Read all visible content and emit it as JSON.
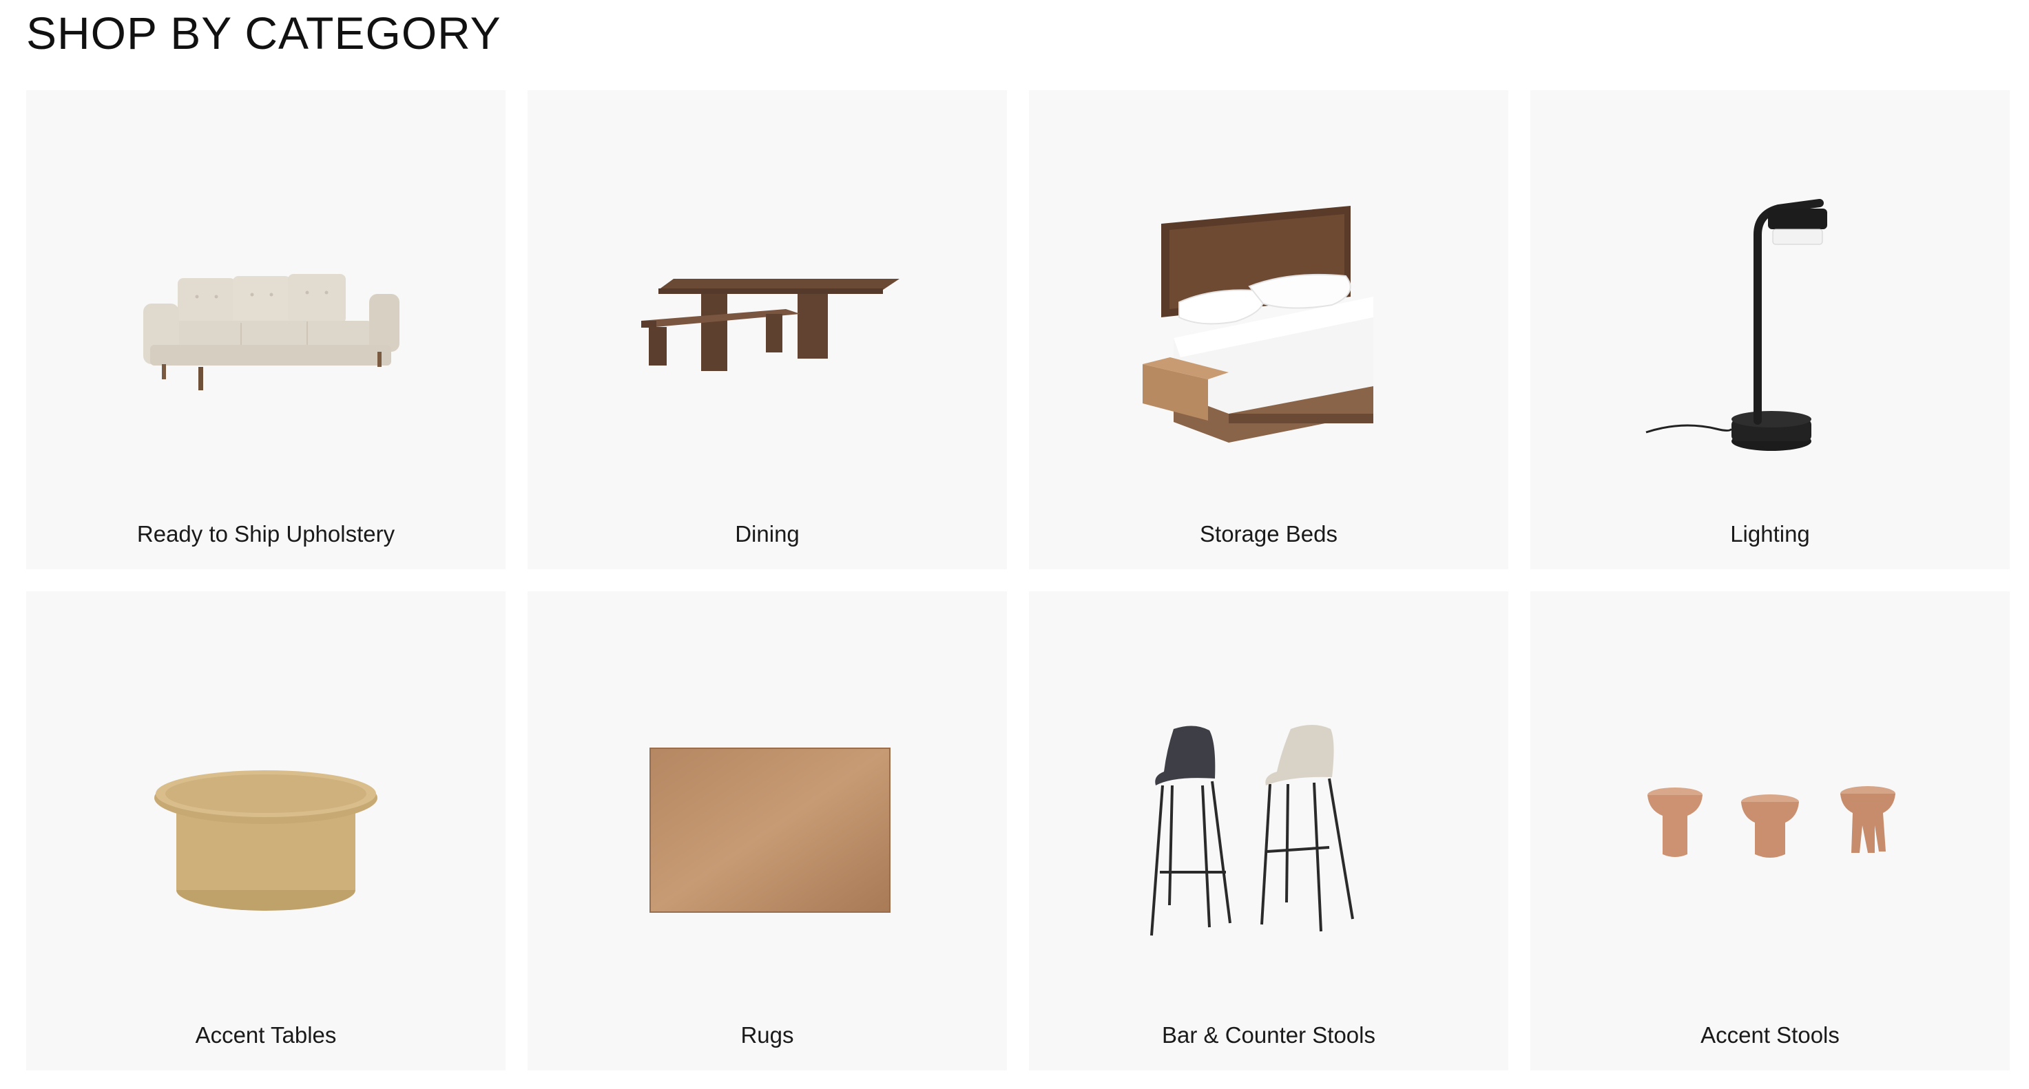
{
  "section": {
    "title": "SHOP BY CATEGORY"
  },
  "categories": [
    {
      "label": "Ready to Ship Upholstery",
      "icon": "sofa-image"
    },
    {
      "label": "Dining",
      "icon": "dining-table-image"
    },
    {
      "label": "Storage Beds",
      "icon": "storage-bed-image"
    },
    {
      "label": "Lighting",
      "icon": "table-lamp-image"
    },
    {
      "label": "Accent Tables",
      "icon": "accent-table-image"
    },
    {
      "label": "Rugs",
      "icon": "rug-image"
    },
    {
      "label": "Bar & Counter Stools",
      "icon": "bar-stools-image"
    },
    {
      "label": "Accent Stools",
      "icon": "accent-stools-image"
    }
  ],
  "colors": {
    "card_background": "#f8f8f8",
    "text": "#111111"
  }
}
